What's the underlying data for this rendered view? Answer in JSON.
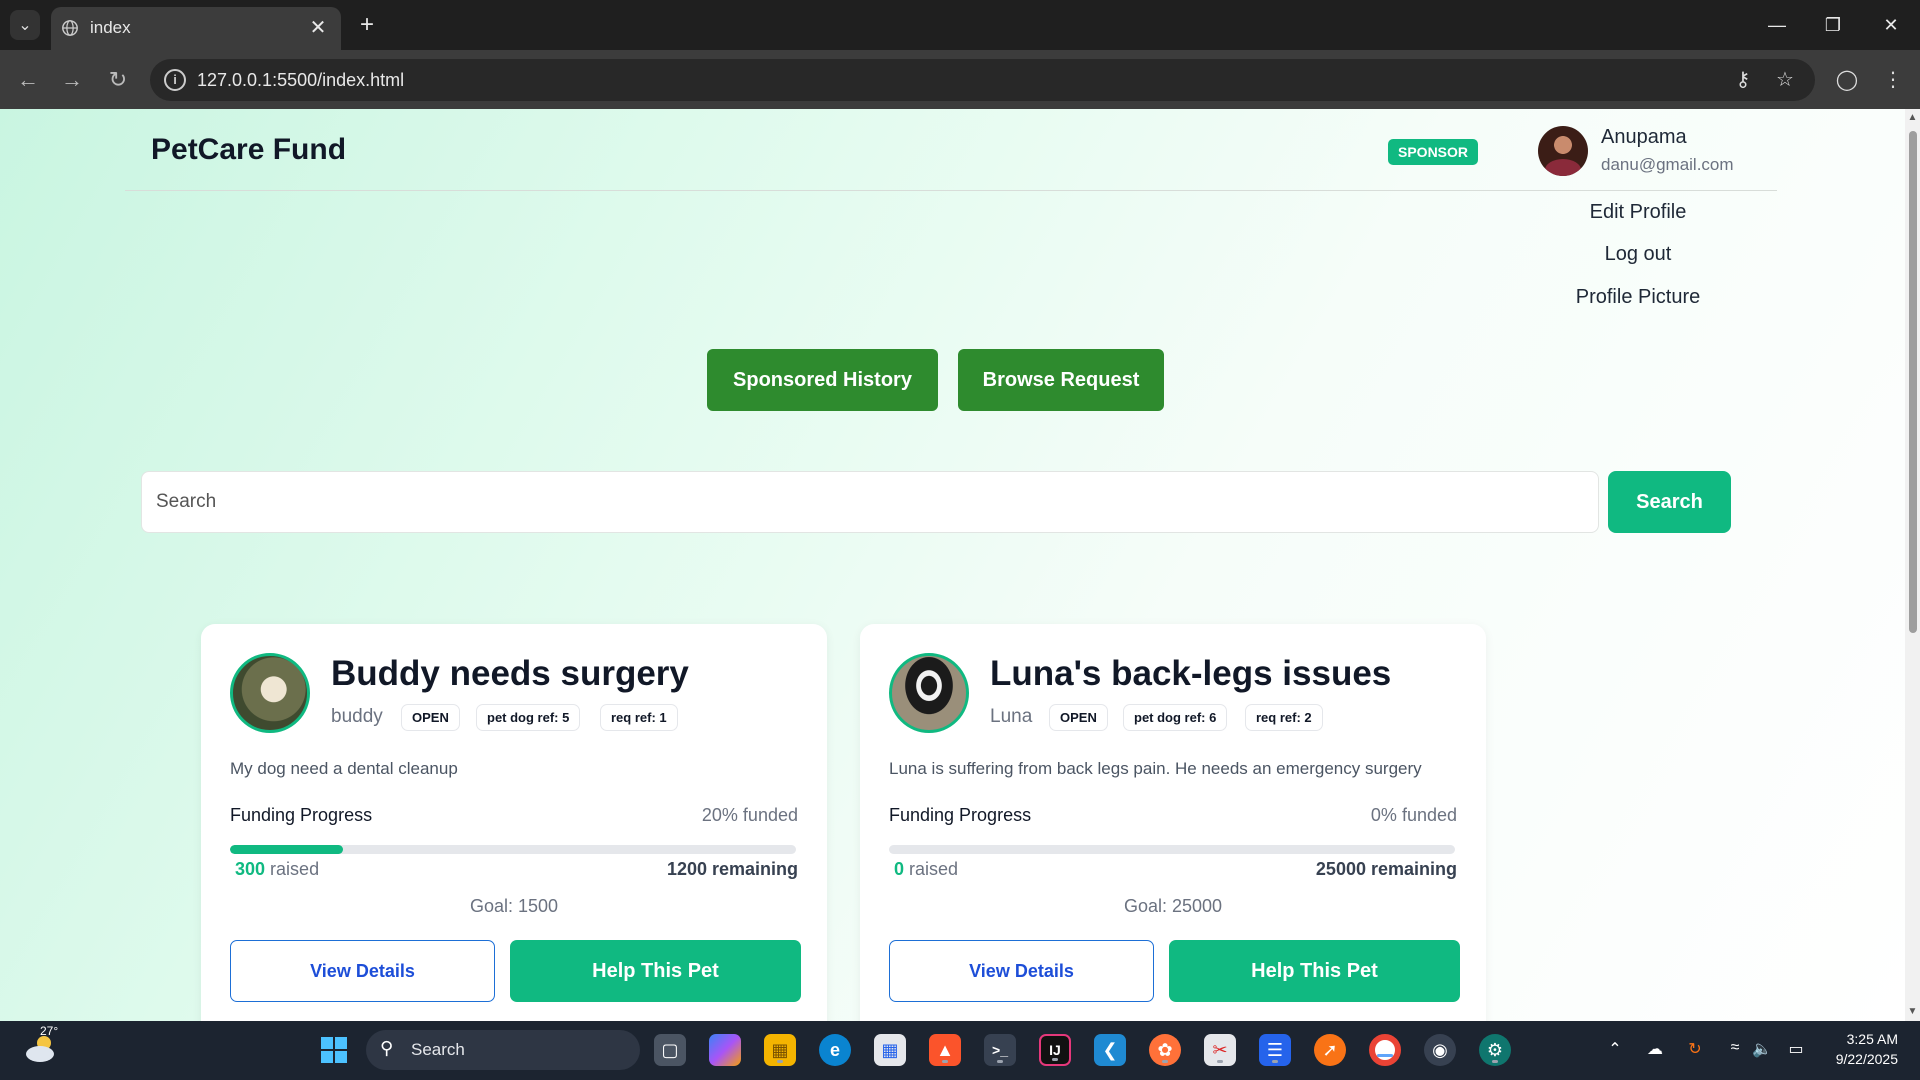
{
  "browser": {
    "tab_title": "index",
    "url": "127.0.0.1:5500/index.html"
  },
  "header": {
    "brand": "PetCare Fund",
    "role_badge": "SPONSOR",
    "user_name": "Anupama",
    "user_email": "danu@gmail.com"
  },
  "profile_menu": {
    "items": [
      {
        "label": "Edit Profile"
      },
      {
        "label": "Log out"
      },
      {
        "label": "Profile Picture"
      }
    ]
  },
  "actions": {
    "sponsored_history": "Sponsored History",
    "browse_request": "Browse Request"
  },
  "search": {
    "placeholder": "Search",
    "button": "Search"
  },
  "cards": [
    {
      "title": "Buddy needs surgery",
      "pet_name": "buddy",
      "status": "OPEN",
      "pet_ref": "pet dog ref: 5",
      "req_ref": "req ref: 1",
      "description": "My dog need a dental cleanup",
      "funding_label": "Funding Progress",
      "funded_text": "20% funded",
      "funded_fraction": 0.2,
      "raised": "300",
      "raised_suffix": " raised",
      "remaining": "1200 remaining",
      "goal": "Goal: 1500",
      "view_details": "View Details",
      "help": "Help This Pet"
    },
    {
      "title": "Luna's back-legs issues",
      "pet_name": "Luna",
      "status": "OPEN",
      "pet_ref": "pet dog ref: 6",
      "req_ref": "req ref: 2",
      "description": "Luna is suffering from back legs pain. He needs an emergency surgery",
      "funding_label": "Funding Progress",
      "funded_text": "0% funded",
      "funded_fraction": 0,
      "raised": "0",
      "raised_suffix": " raised",
      "remaining": "25000 remaining",
      "goal": "Goal: 25000",
      "view_details": "View Details",
      "help": "Help This Pet"
    }
  ],
  "taskbar": {
    "weather_temp": "27°",
    "search_placeholder": "Search",
    "time": "3:25 AM",
    "date": "9/22/2025"
  },
  "colors": {
    "accent_green": "#10b981",
    "nav_button_green": "#2e8b2e",
    "link_blue": "#1d4ed8"
  }
}
